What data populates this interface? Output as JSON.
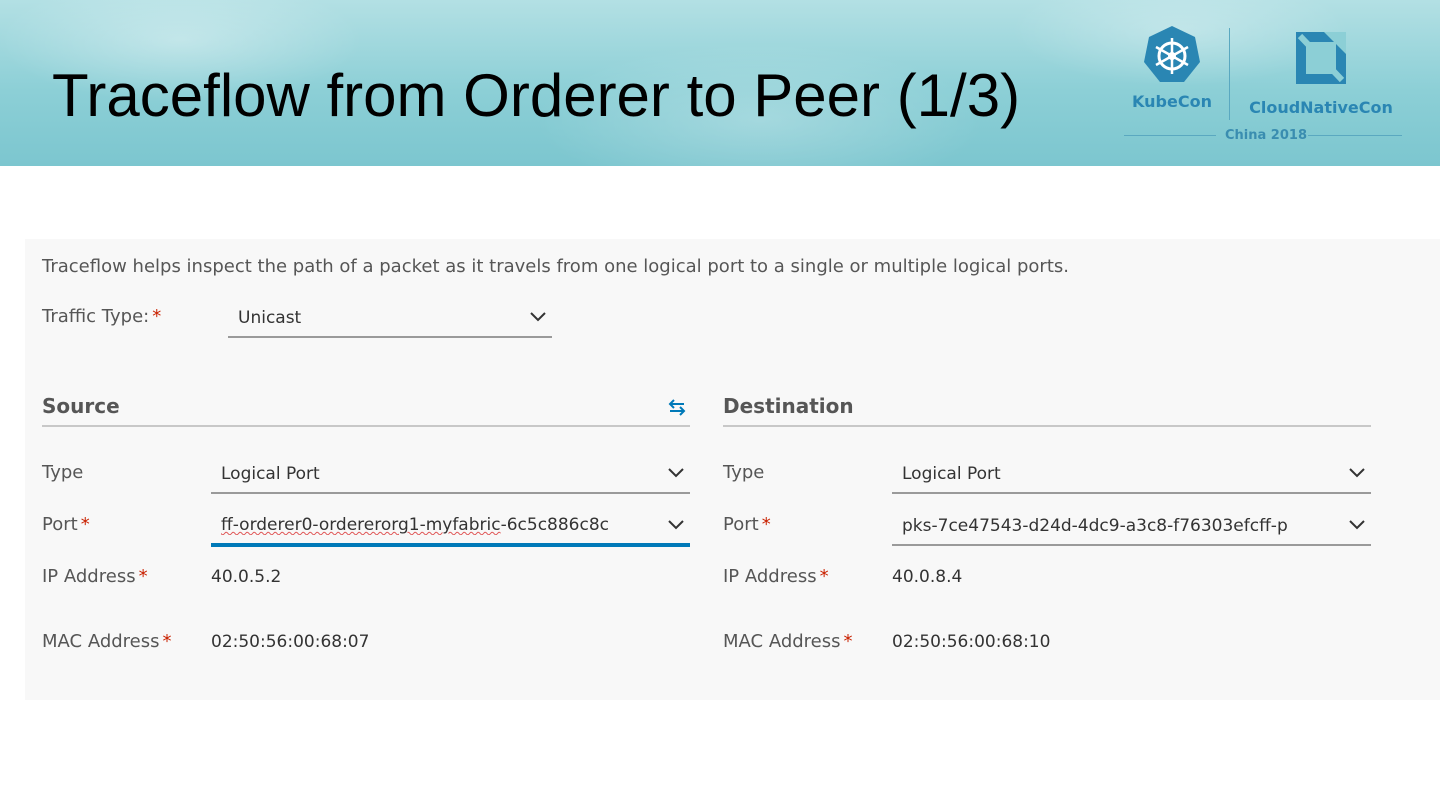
{
  "slide": {
    "title": "Traceflow from Orderer to Peer (1/3)",
    "logos": {
      "kubecon": "KubeCon",
      "cloudnativecon": "CloudNativeCon",
      "event": "China 2018"
    }
  },
  "form": {
    "description": "Traceflow helps inspect the path of a packet as it travels from one logical port to a single or multiple logical ports.",
    "traffic_type": {
      "label": "Traffic Type:",
      "required": "*",
      "value": "Unicast"
    },
    "source": {
      "title": "Source",
      "swap_icon": "swap-arrows-icon",
      "type": {
        "label": "Type",
        "value": "Logical Port"
      },
      "port": {
        "label": "Port",
        "required": "*",
        "value_misspelled": "ff-orderer0-ordererorg1-myfabric",
        "value_rest": "-6c5c886c8c"
      },
      "ip_address": {
        "label": "IP Address",
        "required": "*",
        "value": "40.0.5.2"
      },
      "mac_address": {
        "label": "MAC Address",
        "required": "*",
        "value": "02:50:56:00:68:07"
      }
    },
    "destination": {
      "title": "Destination",
      "type": {
        "label": "Type",
        "value": "Logical Port"
      },
      "port": {
        "label": "Port",
        "required": "*",
        "value": "pks-7ce47543-d24d-4dc9-a3c8-f76303efcff-p"
      },
      "ip_address": {
        "label": "IP Address",
        "required": "*",
        "value": "40.0.8.4"
      },
      "mac_address": {
        "label": "MAC Address",
        "required": "*",
        "value": "02:50:56:00:68:10"
      }
    }
  },
  "colors": {
    "accent_focus": "#0079b8",
    "required": "#c92100",
    "logo_blue": "#2a86b3"
  },
  "icons": [
    "chevron-down-icon",
    "swap-arrows-icon",
    "kubernetes-helm-icon",
    "cncf-logo-icon"
  ]
}
